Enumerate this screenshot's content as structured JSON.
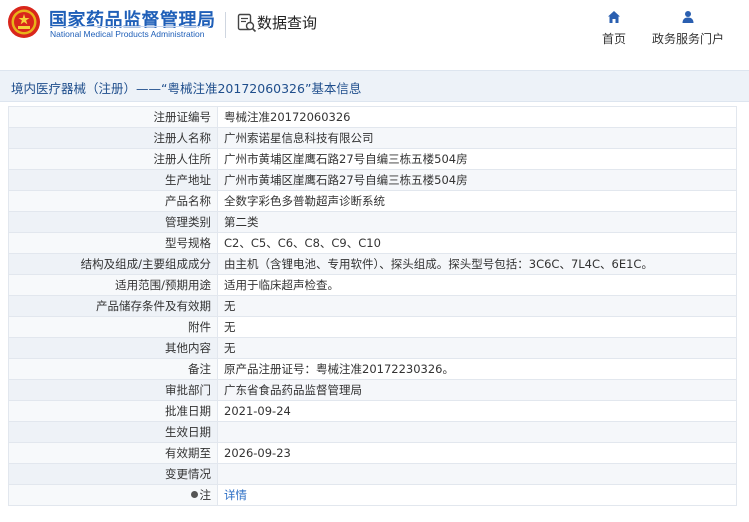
{
  "header": {
    "brand_cn": "国家药品监督管理局",
    "brand_en": "National Medical Products Administration",
    "query_label": "数据查询",
    "nav_home": "首页",
    "nav_service": "政务服务门户"
  },
  "title": "境内医疗器械（注册）——“粤械注准20172060326”基本信息",
  "rows": [
    {
      "k": "注册证编号",
      "v": "粤械注准20172060326"
    },
    {
      "k": "注册人名称",
      "v": "广州索诺星信息科技有限公司"
    },
    {
      "k": "注册人住所",
      "v": "广州市黄埔区崖鹰石路27号自编三栋五楼504房"
    },
    {
      "k": "生产地址",
      "v": "广州市黄埔区崖鹰石路27号自编三栋五楼504房"
    },
    {
      "k": "产品名称",
      "v": "全数字彩色多普勒超声诊断系统"
    },
    {
      "k": "管理类别",
      "v": "第二类"
    },
    {
      "k": "型号规格",
      "v": "C2、C5、C6、C8、C9、C10"
    },
    {
      "k": "结构及组成/主要组成成分",
      "v": "由主机（含锂电池、专用软件）、探头组成。探头型号包括：3C6C、7L4C、6E1C。"
    },
    {
      "k": "适用范围/预期用途",
      "v": "适用于临床超声检查。"
    },
    {
      "k": "产品储存条件及有效期",
      "v": "无"
    },
    {
      "k": "附件",
      "v": "无"
    },
    {
      "k": "其他内容",
      "v": "无"
    },
    {
      "k": "备注",
      "v": "原产品注册证号：粤械注准20172230326。"
    },
    {
      "k": "审批部门",
      "v": "广东省食品药品监督管理局"
    },
    {
      "k": "批准日期",
      "v": "2021-09-24"
    },
    {
      "k": "生效日期",
      "v": ""
    },
    {
      "k": "有效期至",
      "v": "2026-09-23"
    },
    {
      "k": "变更情况",
      "v": ""
    }
  ],
  "note_row": {
    "k": "注",
    "v": "详情"
  },
  "colors": {
    "brand": "#1f5fb8",
    "link": "#2a6dc4",
    "title_bar": "#edf2f8"
  }
}
